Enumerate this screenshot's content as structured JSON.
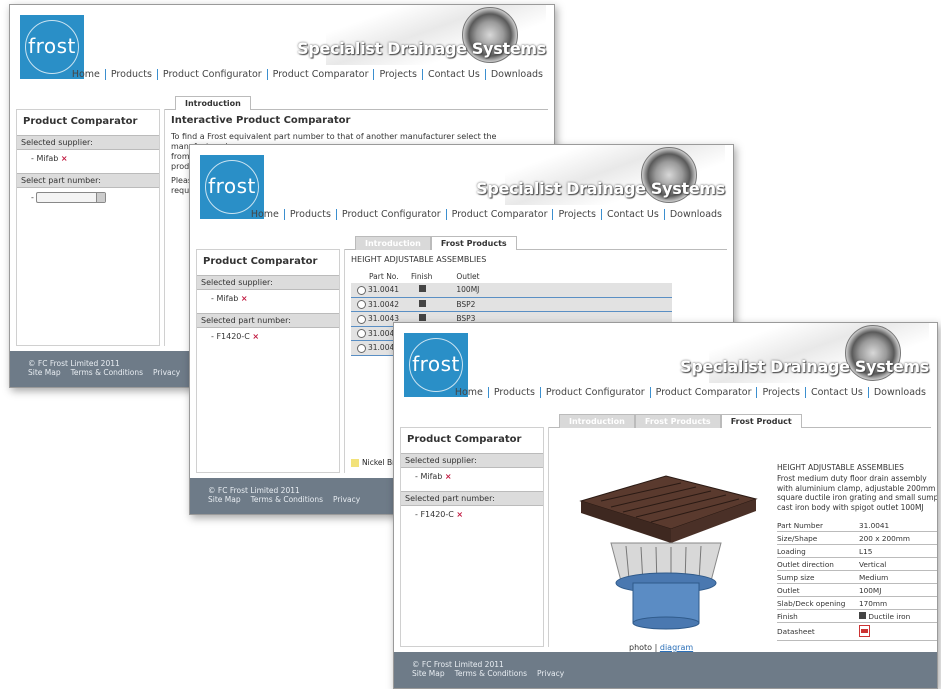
{
  "brand": {
    "logo_text": "frost",
    "tagline": "Specialist Drainage Systems"
  },
  "nav": [
    "Home",
    "Products",
    "Product Configurator",
    "Product Comparator",
    "Projects",
    "Contact Us",
    "Downloads"
  ],
  "sidebar": {
    "title": "Product Comparator",
    "supplier_label": "Selected supplier:",
    "supplier_value": "Mifab",
    "part_label_select": "Select part number:",
    "part_select_value": "-",
    "part_label_selected": "Selected part number:",
    "part_value": "F1420-C",
    "remove_mark": "×"
  },
  "footer": {
    "copyright": "© FC Frost Limited 2011",
    "links": [
      "Site Map",
      "Terms & Conditions",
      "Privacy"
    ]
  },
  "window1": {
    "tabs": [
      "Introduction"
    ],
    "heading": "Interactive Product Comparator",
    "text1": "To find a Frost equivalent part number to that of another manufacturer select the manufacturer's name",
    "text2": "from t",
    "text3": "produ",
    "text4": "Please",
    "text5": "requir"
  },
  "window2": {
    "tabs": [
      "Introduction",
      "Frost Products"
    ],
    "heading": "HEIGHT ADJUSTABLE ASSEMBLIES",
    "columns": [
      "Part No.",
      "Finish",
      "Outlet"
    ],
    "rows": [
      {
        "part": "31.0041",
        "outlet": "100MJ"
      },
      {
        "part": "31.0042",
        "outlet": "BSP2"
      },
      {
        "part": "31.0043",
        "outlet": "BSP3"
      },
      {
        "part": "31.0044",
        "outlet": ""
      },
      {
        "part": "31.0047",
        "outlet": ""
      }
    ],
    "legend": "Nickel Bro"
  },
  "window3": {
    "tabs": [
      "Introduction",
      "Frost Products",
      "Frost Product"
    ],
    "heading": "HEIGHT ADJUSTABLE ASSEMBLIES",
    "description": "Frost medium duty floor drain assembly with aluminium clamp, adjustable 200mm square ductile iron grating and small sump cast iron body with spigot outlet 100MJ",
    "specs": [
      {
        "k": "Part Number",
        "v": "31.0041"
      },
      {
        "k": "Size/Shape",
        "v": "200 x 200mm"
      },
      {
        "k": "Loading",
        "v": "L15"
      },
      {
        "k": "Outlet direction",
        "v": "Vertical"
      },
      {
        "k": "Sump size",
        "v": "Medium"
      },
      {
        "k": "Outlet",
        "v": "100MJ"
      },
      {
        "k": "Slab/Deck opening",
        "v": "170mm"
      },
      {
        "k": "Finish",
        "v": "Ductile iron"
      },
      {
        "k": "Datasheet",
        "v": ""
      }
    ],
    "caption_photo": "photo",
    "caption_sep": "|",
    "caption_diagram": "diagram"
  }
}
